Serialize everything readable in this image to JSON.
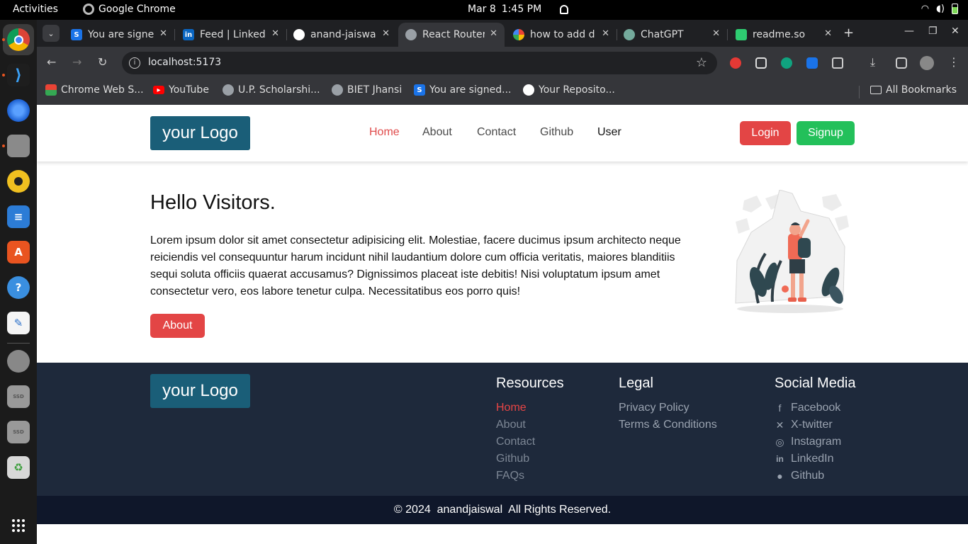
{
  "system": {
    "activities": "Activities",
    "app_name": "Google Chrome",
    "date": "Mar 8",
    "time": "1:45 PM"
  },
  "tabs": [
    {
      "title": "You are signe",
      "icon": "s-icon",
      "color": "#1a73e8",
      "active": false
    },
    {
      "title": "Feed | Linked",
      "icon": "linkedin-icon",
      "color": "#0a66c2",
      "active": false
    },
    {
      "title": "anand-jaiswa",
      "icon": "github-icon",
      "color": "#ffffff",
      "active": false
    },
    {
      "title": "React Router",
      "icon": "globe-icon",
      "color": "#9aa0a6",
      "active": true
    },
    {
      "title": "how to add d",
      "icon": "google-icon",
      "color": "#4285f4",
      "active": false
    },
    {
      "title": "ChatGPT",
      "icon": "chatgpt-icon",
      "color": "#74aa9c",
      "active": false
    },
    {
      "title": "readme.so",
      "icon": "readme-icon",
      "color": "#2ecc71",
      "active": false
    }
  ],
  "address": {
    "url": "localhost:5173"
  },
  "bookmarks": [
    {
      "label": "Chrome Web S...",
      "icon": "chrome-web-store-icon"
    },
    {
      "label": "YouTube",
      "icon": "youtube-icon"
    },
    {
      "label": "U.P. Scholarshi...",
      "icon": "globe-icon"
    },
    {
      "label": "BIET Jhansi",
      "icon": "globe-icon"
    },
    {
      "label": "You are signed...",
      "icon": "s-icon"
    },
    {
      "label": "Your Reposito...",
      "icon": "github-icon"
    }
  ],
  "all_bookmarks": "All Bookmarks",
  "site": {
    "logo": "your Logo",
    "nav": [
      "Home",
      "About",
      "Contact",
      "Github",
      "User"
    ],
    "login": "Login",
    "signup": "Signup",
    "hero": {
      "title": "Hello Visitors.",
      "text": "Lorem ipsum dolor sit amet consectetur adipisicing elit. Molestiae, facere ducimus ipsum architecto neque reiciendis vel consequuntur harum incidunt nihil laudantium dolore cum officia veritatis, maiores blanditiis sequi soluta officiis quaerat accusamus? Dignissimos placeat iste debitis! Nisi voluptatum ipsum amet consectetur vero, eos labore tenetur culpa. Necessitatibus eos porro quis!",
      "button": "About"
    },
    "footer": {
      "logo": "your Logo",
      "resources": {
        "heading": "Resources",
        "links": [
          "Home",
          "About",
          "Contact",
          "Github",
          "FAQs"
        ]
      },
      "legal": {
        "heading": "Legal",
        "links": [
          "Privacy Policy",
          "Terms & Conditions"
        ]
      },
      "social": {
        "heading": "Social Media",
        "links": [
          {
            "label": "Facebook",
            "icon": "facebook-icon"
          },
          {
            "label": "X-twitter",
            "icon": "x-twitter-icon"
          },
          {
            "label": "Instagram",
            "icon": "instagram-icon"
          },
          {
            "label": "LinkedIn",
            "icon": "linkedin-icon"
          },
          {
            "label": "Github",
            "icon": "github-icon"
          }
        ]
      },
      "copyright": "© 2024  anandjaiswal  All Rights Reserved."
    }
  },
  "colors": {
    "brand_logo": "#1a5e78",
    "accent_red": "#e34545",
    "signup_green": "#23c05a",
    "footer_bg": "#1e293b",
    "copyright_bg": "#0f172a"
  }
}
